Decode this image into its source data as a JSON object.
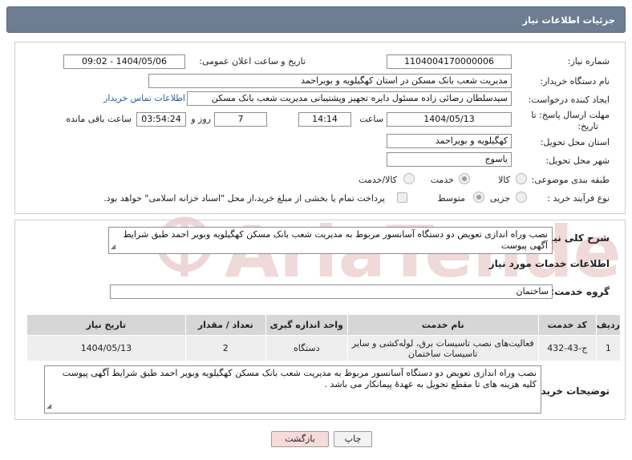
{
  "header": {
    "title": "جزئیات اطلاعات نیاز"
  },
  "form": {
    "need_number_label": "شماره نیاز:",
    "need_number": "1104004170000006",
    "announce_label": "تاریخ و ساعت اعلان عمومی:",
    "announce_value": "1404/05/06 - 09:02",
    "buyer_org_label": "نام دستگاه خریدار:",
    "buyer_org": "مدیریت شعب بانک مسکن در استان کهگیلویه و بویراحمد",
    "requester_label": "ایجاد کننده درخواست:",
    "requester": "سیدسلطان رضائی زاده مسئول دایره تجهیز وپشتیبانی  مدیریت شعب بانک مسکن",
    "contact_link": "اطلاعات تماس خریدار",
    "deadline_label_1": "مهلت ارسال پاسخ: تا",
    "deadline_label_2": "تاریخ:",
    "deadline_date": "1404/05/13",
    "time_label": "ساعت",
    "deadline_time": "14:14",
    "days_value": "7",
    "days_label": "روز و",
    "remaining_value": "03:54:24",
    "remaining_label": "ساعت باقی مانده",
    "province_label": "استان محل تحویل:",
    "province": "کهگیلویه و بویراحمد",
    "city_label": "شهر محل تحویل:",
    "city": "یاسوج",
    "category_label": "طبقه بندی موضوعی:",
    "category_options": [
      "کالا",
      "خدمت",
      "کالا/خدمت"
    ],
    "process_label": "نوع فرآیند خرید :",
    "process_options": [
      "جزیی",
      "متوسط"
    ],
    "payment_note": "پرداخت تمام یا بخشی از مبلغ خرید،از محل \"اسناد خزانه اسلامی\" خواهد بود."
  },
  "details": {
    "summary_label": "شرح کلی نیاز:",
    "summary": "نصب وراه اندازی تعویض دو دستگاه آسانسور مربوط به مدیریت شعب بانک مسکن کهگیلویه وبویر احمد طبق شرایط آگهی پیوست",
    "services_heading": "اطلاعات خدمات مورد نیاز",
    "group_label": "گروه خدمت:",
    "group_value": "ساختمان"
  },
  "table": {
    "headers": [
      "ردیف",
      "کد خدمت",
      "نام خدمت",
      "واحد اندازه گیری",
      "تعداد / مقدار",
      "تاریخ نیاز"
    ],
    "rows": [
      [
        "1",
        "ج-43-432",
        "فعالیت‌های نصب تاسیسات برق، لوله‌کشی و سایر تاسیسات ساختمان",
        "دستگاه",
        "2",
        "1404/05/13"
      ]
    ]
  },
  "buyer_notes": {
    "label": "توضیحات خریدار:",
    "text": "نصب وراه اندازی تعویض دو دستگاه آسانسور مربوط به مدیریت شعب بانک مسکن کهگیلویه وبویر احمد طبق  شرایط آگهی پیوست کلیه هزینه های تا مقطع تحویل به عهدۀ پیمانکار می باشد ."
  },
  "actions": {
    "print": "چاپ",
    "back": "بازگشت"
  },
  "colors": {
    "header_bg": "#6d7d92",
    "back_bg": "#f7dada",
    "print_bg": "#f2f2f2",
    "watermark": "#e9c9c9"
  },
  "watermark_icon": "ariatender-logo-icon"
}
